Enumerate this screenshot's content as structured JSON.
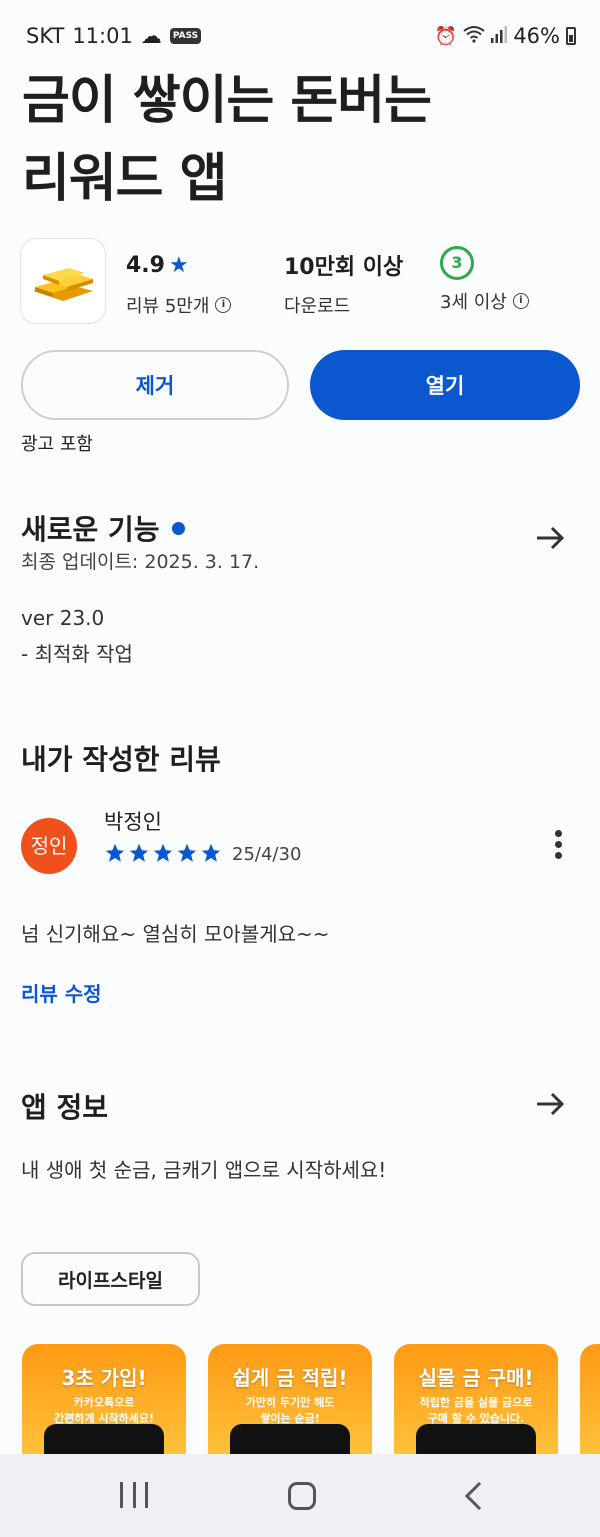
{
  "status_bar": {
    "carrier": "SKT",
    "time": "11:01",
    "pass_badge": "PASS",
    "battery": "46%"
  },
  "app": {
    "title_line1": "금이 쌓이는 돈버는",
    "title_line2": "리워드 앱",
    "icon": "gold-bars-icon",
    "rating_value": "4.9",
    "rating_label": "리뷰 5만개",
    "downloads_value": "10만회 이상",
    "downloads_label": "다운로드",
    "age_value": "3",
    "age_label": "3세 이상",
    "remove_label": "제거",
    "open_label": "열기",
    "ads_label": "광고 포함"
  },
  "whats_new": {
    "title": "새로운 기능",
    "updated": "최종 업데이트: 2025. 3. 17.",
    "version": "ver 23.0",
    "notes": "- 최적화 작업"
  },
  "my_review": {
    "title": "내가 작성한 리뷰",
    "avatar_text": "정인",
    "author": "박정인",
    "stars": 5,
    "date": "25/4/30",
    "text": "넘 신기해요~ 열심히 모아볼게요~~",
    "edit_label": "리뷰 수정"
  },
  "about": {
    "title": "앱 정보",
    "description": "내 생애 첫 순금, 금캐기 앱으로 시작하세요!",
    "category": "라이프스타일"
  },
  "screenshots": [
    {
      "heading": "3초 가입!",
      "line1": "카카오톡으로",
      "line2": "간편하게 시작하세요!"
    },
    {
      "heading": "쉽게 금 적립!",
      "line1": "가만히 두기만 해도",
      "line2": "쌓이는 순금!"
    },
    {
      "heading": "실물 금 구매!",
      "line1": "적립한 금을 실물 금으로",
      "line2": "구매 할 수 있습니다."
    }
  ],
  "colors": {
    "accent": "#0b57d0",
    "avatar": "#f0501c",
    "age_badge": "#2ea94c",
    "screenshot_bg": "#ff9a14"
  }
}
